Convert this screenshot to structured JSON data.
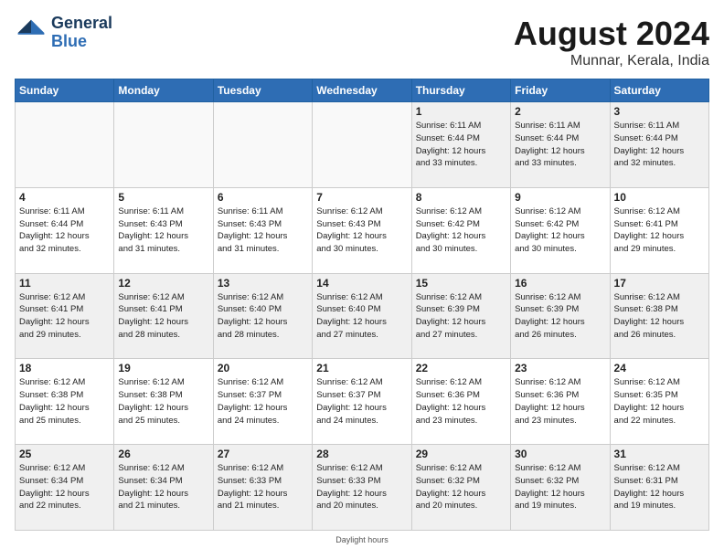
{
  "app": {
    "logo_line1": "General",
    "logo_line2": "Blue",
    "month_title": "August 2024",
    "location": "Munnar, Kerala, India",
    "footer_note": "Daylight hours"
  },
  "weekdays": [
    "Sunday",
    "Monday",
    "Tuesday",
    "Wednesday",
    "Thursday",
    "Friday",
    "Saturday"
  ],
  "weeks": [
    [
      {
        "day": "",
        "info": ""
      },
      {
        "day": "",
        "info": ""
      },
      {
        "day": "",
        "info": ""
      },
      {
        "day": "",
        "info": ""
      },
      {
        "day": "1",
        "info": "Sunrise: 6:11 AM\nSunset: 6:44 PM\nDaylight: 12 hours\nand 33 minutes."
      },
      {
        "day": "2",
        "info": "Sunrise: 6:11 AM\nSunset: 6:44 PM\nDaylight: 12 hours\nand 33 minutes."
      },
      {
        "day": "3",
        "info": "Sunrise: 6:11 AM\nSunset: 6:44 PM\nDaylight: 12 hours\nand 32 minutes."
      }
    ],
    [
      {
        "day": "4",
        "info": "Sunrise: 6:11 AM\nSunset: 6:44 PM\nDaylight: 12 hours\nand 32 minutes."
      },
      {
        "day": "5",
        "info": "Sunrise: 6:11 AM\nSunset: 6:43 PM\nDaylight: 12 hours\nand 31 minutes."
      },
      {
        "day": "6",
        "info": "Sunrise: 6:11 AM\nSunset: 6:43 PM\nDaylight: 12 hours\nand 31 minutes."
      },
      {
        "day": "7",
        "info": "Sunrise: 6:12 AM\nSunset: 6:43 PM\nDaylight: 12 hours\nand 30 minutes."
      },
      {
        "day": "8",
        "info": "Sunrise: 6:12 AM\nSunset: 6:42 PM\nDaylight: 12 hours\nand 30 minutes."
      },
      {
        "day": "9",
        "info": "Sunrise: 6:12 AM\nSunset: 6:42 PM\nDaylight: 12 hours\nand 30 minutes."
      },
      {
        "day": "10",
        "info": "Sunrise: 6:12 AM\nSunset: 6:41 PM\nDaylight: 12 hours\nand 29 minutes."
      }
    ],
    [
      {
        "day": "11",
        "info": "Sunrise: 6:12 AM\nSunset: 6:41 PM\nDaylight: 12 hours\nand 29 minutes."
      },
      {
        "day": "12",
        "info": "Sunrise: 6:12 AM\nSunset: 6:41 PM\nDaylight: 12 hours\nand 28 minutes."
      },
      {
        "day": "13",
        "info": "Sunrise: 6:12 AM\nSunset: 6:40 PM\nDaylight: 12 hours\nand 28 minutes."
      },
      {
        "day": "14",
        "info": "Sunrise: 6:12 AM\nSunset: 6:40 PM\nDaylight: 12 hours\nand 27 minutes."
      },
      {
        "day": "15",
        "info": "Sunrise: 6:12 AM\nSunset: 6:39 PM\nDaylight: 12 hours\nand 27 minutes."
      },
      {
        "day": "16",
        "info": "Sunrise: 6:12 AM\nSunset: 6:39 PM\nDaylight: 12 hours\nand 26 minutes."
      },
      {
        "day": "17",
        "info": "Sunrise: 6:12 AM\nSunset: 6:38 PM\nDaylight: 12 hours\nand 26 minutes."
      }
    ],
    [
      {
        "day": "18",
        "info": "Sunrise: 6:12 AM\nSunset: 6:38 PM\nDaylight: 12 hours\nand 25 minutes."
      },
      {
        "day": "19",
        "info": "Sunrise: 6:12 AM\nSunset: 6:38 PM\nDaylight: 12 hours\nand 25 minutes."
      },
      {
        "day": "20",
        "info": "Sunrise: 6:12 AM\nSunset: 6:37 PM\nDaylight: 12 hours\nand 24 minutes."
      },
      {
        "day": "21",
        "info": "Sunrise: 6:12 AM\nSunset: 6:37 PM\nDaylight: 12 hours\nand 24 minutes."
      },
      {
        "day": "22",
        "info": "Sunrise: 6:12 AM\nSunset: 6:36 PM\nDaylight: 12 hours\nand 23 minutes."
      },
      {
        "day": "23",
        "info": "Sunrise: 6:12 AM\nSunset: 6:36 PM\nDaylight: 12 hours\nand 23 minutes."
      },
      {
        "day": "24",
        "info": "Sunrise: 6:12 AM\nSunset: 6:35 PM\nDaylight: 12 hours\nand 22 minutes."
      }
    ],
    [
      {
        "day": "25",
        "info": "Sunrise: 6:12 AM\nSunset: 6:34 PM\nDaylight: 12 hours\nand 22 minutes."
      },
      {
        "day": "26",
        "info": "Sunrise: 6:12 AM\nSunset: 6:34 PM\nDaylight: 12 hours\nand 21 minutes."
      },
      {
        "day": "27",
        "info": "Sunrise: 6:12 AM\nSunset: 6:33 PM\nDaylight: 12 hours\nand 21 minutes."
      },
      {
        "day": "28",
        "info": "Sunrise: 6:12 AM\nSunset: 6:33 PM\nDaylight: 12 hours\nand 20 minutes."
      },
      {
        "day": "29",
        "info": "Sunrise: 6:12 AM\nSunset: 6:32 PM\nDaylight: 12 hours\nand 20 minutes."
      },
      {
        "day": "30",
        "info": "Sunrise: 6:12 AM\nSunset: 6:32 PM\nDaylight: 12 hours\nand 19 minutes."
      },
      {
        "day": "31",
        "info": "Sunrise: 6:12 AM\nSunset: 6:31 PM\nDaylight: 12 hours\nand 19 minutes."
      }
    ]
  ]
}
